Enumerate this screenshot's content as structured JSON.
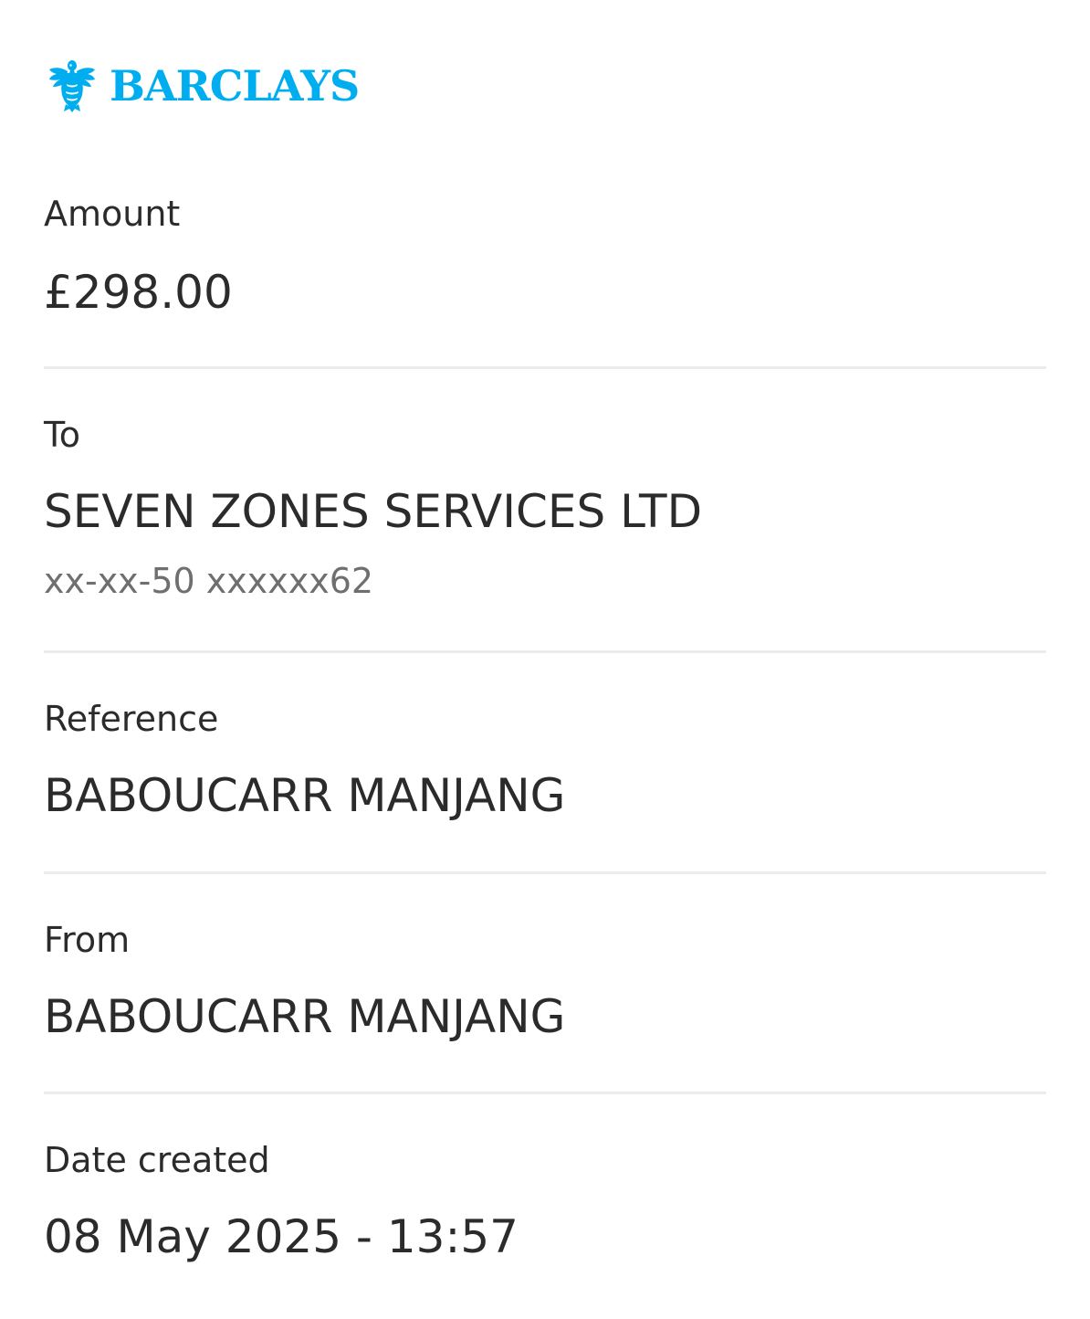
{
  "brand": {
    "name": "BARCLAYS",
    "logo_icon": "eagle-icon",
    "color": "#00aeef"
  },
  "amount": {
    "label": "Amount",
    "value": "£298.00"
  },
  "to": {
    "label": "To",
    "value": "SEVEN ZONES SERVICES LTD",
    "account": "xx-xx-50 xxxxxx62"
  },
  "reference": {
    "label": "Reference",
    "value": "BABOUCARR MANJANG"
  },
  "from": {
    "label": "From",
    "value": "BABOUCARR MANJANG"
  },
  "date_created": {
    "label": "Date created",
    "value": "08 May 2025 - 13:57"
  }
}
